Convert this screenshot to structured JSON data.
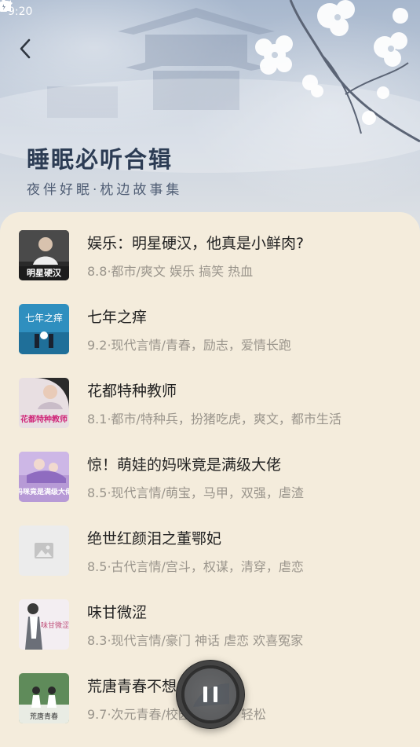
{
  "status_bar": {
    "time": "9:20"
  },
  "header": {
    "title": "睡眠必听合辑",
    "subtitle": "夜伴好眠·枕边故事集"
  },
  "books": [
    {
      "title": "娱乐：明星硬汉，他真是小鲜肉?",
      "meta": "8.8·都市/爽文 娱乐 搞笑 热血",
      "cover_text": "明星硬汉",
      "cover_color": "#2a2a2a"
    },
    {
      "title": "七年之痒",
      "meta": "9.2·现代言情/青春，励志，爱情长跑",
      "cover_text": "七年之痒",
      "cover_color": "#2f8fbf"
    },
    {
      "title": "花都特种教师",
      "meta": "8.1·都市/特种兵，扮猪吃虎，爽文，都市生活",
      "cover_text": "花都特种教师",
      "cover_color": "#e8dfe2"
    },
    {
      "title": "惊！萌娃的妈咪竟是满级大佬",
      "meta": "8.5·现代言情/萌宝，马甲，双强，虐渣",
      "cover_text": "妈咪竟是满级大佬",
      "cover_color": "#b79ad6"
    },
    {
      "title": "绝世红颜泪之董鄂妃",
      "meta": "8.5·古代言情/宫斗，权谋，清穿，虐恋",
      "cover_text": "",
      "cover_color": "#ececec"
    },
    {
      "title": "味甘微涩",
      "meta": "8.3·现代言情/豪门 神话 虐恋 欢喜冤家",
      "cover_text": "味甘微涩",
      "cover_color": "#f3eef2"
    },
    {
      "title": "荒唐青春不想",
      "meta": "9.7·次元青春/校园，甜文，轻松",
      "cover_text": "荒唐青春",
      "cover_color": "#5f8b5a"
    }
  ],
  "colors": {
    "background": "#f4ecdc",
    "title": "#2c3c54",
    "meta": "#9a958c"
  }
}
